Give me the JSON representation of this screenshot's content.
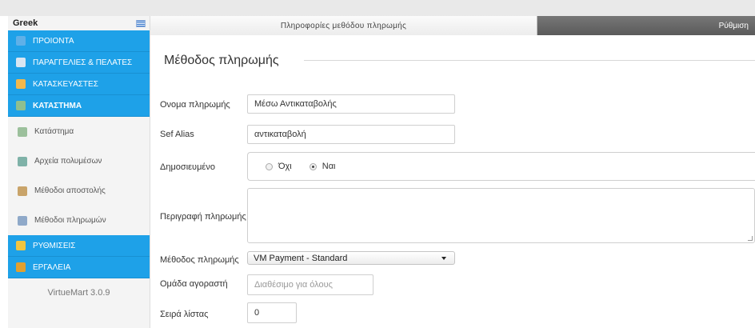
{
  "language": {
    "label": "Greek",
    "icon": "greece-flag-icon"
  },
  "sidebar": {
    "items": [
      {
        "label": "ΠΡΟΙΟΝΤΑ",
        "icon": "products-icon",
        "color": "#5fb0e8",
        "style": "blue"
      },
      {
        "label": "ΠΑΡΑΓΓΕΛΙΕΣ & ΠΕΛΑΤΕΣ",
        "icon": "orders-icon",
        "color": "#d9e6f2",
        "style": "blue"
      },
      {
        "label": "ΚΑΤΑΣΚΕΥΑΣΤΕΣ",
        "icon": "wrench-icon",
        "color": "#f2b84b",
        "style": "blue"
      },
      {
        "label": "ΚΑΤΑΣΤΗΜΑ",
        "icon": "store-icon",
        "color": "#8fbf8f",
        "style": "blue-active"
      },
      {
        "label": "Κατάστημα",
        "icon": "store-small-icon",
        "color": "#9cc09c",
        "style": "sub"
      },
      {
        "label": "Αρχεία πολυμέσων",
        "icon": "media-icon",
        "color": "#7fb2a8",
        "style": "sub"
      },
      {
        "label": "Μέθοδοι αποστολής",
        "icon": "truck-icon",
        "color": "#c9a46a",
        "style": "sub"
      },
      {
        "label": "Μέθοδοι πληρωμών",
        "icon": "payment-icon",
        "color": "#8fa9c9",
        "style": "sub"
      },
      {
        "label": "ΡΥΘΜΙΣΕΙΣ",
        "icon": "settings-icon",
        "color": "#f0c540",
        "style": "blue"
      },
      {
        "label": "ΕΡΓΑΛΕΙΑ",
        "icon": "tools-icon",
        "color": "#e0a030",
        "style": "blue"
      }
    ],
    "version": "VirtueMart 3.0.9"
  },
  "tabs": [
    {
      "label": "Πληροφορίες μεθόδου πληρωμής",
      "active": true
    },
    {
      "label": "Ρύθμιση",
      "active": false
    }
  ],
  "form": {
    "legend": "Μέθοδος πληρωμής",
    "name_label": "Ονομα πληρωμής",
    "name_value": "Μέσω Αντικαταβολής",
    "alias_label": "Sef Alias",
    "alias_value": "αντικαταβολή",
    "published_label": "Δημοσιευμένο",
    "published_options": [
      "Όχι",
      "Ναι"
    ],
    "published_selected": "Ναι",
    "description_label": "Περιγραφή πληρωμής",
    "method_label": "Μέθοδος πληρωμής",
    "method_value": "VM Payment - Standard",
    "group_label": "Ομάδα αγοραστή",
    "group_placeholder": "Διαθέσιμο για όλους",
    "order_label": "Σειρά λίστας",
    "order_value": "0"
  },
  "colors": {
    "accent": "#1ea1e8",
    "tab_dark": "#666666"
  }
}
